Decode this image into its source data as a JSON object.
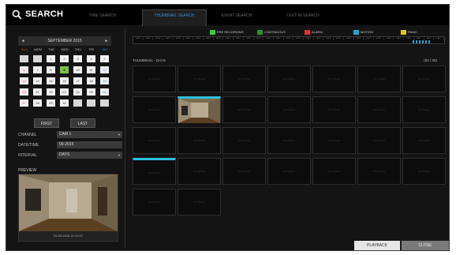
{
  "header": {
    "title": "SEARCH",
    "tabs": [
      {
        "label": "TIME SEARCH",
        "active": false
      },
      {
        "label": "THUMBNAIL SEARCH",
        "active": true
      },
      {
        "label": "EVENT SEARCH",
        "active": false
      },
      {
        "label": "TEXT-IN SEARCH",
        "active": false
      }
    ]
  },
  "calendar": {
    "month_label": "SEPTEMBER 2015",
    "prev_icon": "◄",
    "next_icon": "►",
    "day_names": [
      "SUN",
      "MON",
      "TUE",
      "WED",
      "THU",
      "FRI",
      "SAT"
    ],
    "weeks": [
      [
        "",
        "",
        "1",
        "2",
        "3",
        "4",
        "5"
      ],
      [
        "6",
        "7",
        "8",
        "9",
        "10",
        "11",
        "12"
      ],
      [
        "13",
        "14",
        "15",
        "16",
        "17",
        "18",
        "19"
      ],
      [
        "20",
        "21",
        "22",
        "23",
        "24",
        "25",
        "26"
      ],
      [
        "27",
        "28",
        "29",
        "30",
        "",
        "",
        ""
      ]
    ],
    "selected_day": "9",
    "first_label": "FIRST",
    "last_label": "LAST"
  },
  "fields": {
    "channel_label": "CHANNEL",
    "channel_value": "CAM 1",
    "datetime_label": "DATE/TIME",
    "datetime_value": "09-2015",
    "interval_label": "INTERVAL",
    "interval_value": "DAYS"
  },
  "preview": {
    "label": "PREVIEW",
    "timestamp": "09-09-2015 21:10:01"
  },
  "legend": [
    {
      "label": "PRE RECORDING",
      "color": "#3ad13a"
    },
    {
      "label": "CONTINUOUS",
      "color": "#2f8f2f"
    },
    {
      "label": "ALARM",
      "color": "#e23030"
    },
    {
      "label": "MOTION",
      "color": "#2a9ed8"
    },
    {
      "label": "PANIC",
      "color": "#e2c81e"
    }
  ],
  "timeline": {
    "segment_label": "DAYS",
    "segment_count": 31
  },
  "thumbnails": {
    "label": "THUMBNAIL - DAYS",
    "count_text": "(00 / 30)",
    "no_thumb_text": "NO IMAGE",
    "total": 30
  },
  "footer": {
    "playback_label": "PLAYBACK",
    "close_label": "CLOSE"
  },
  "colors": {
    "accent": "#3b8fd8",
    "calendar_selected": "#7dc241",
    "highlight_bar": "#2cc0e0"
  }
}
